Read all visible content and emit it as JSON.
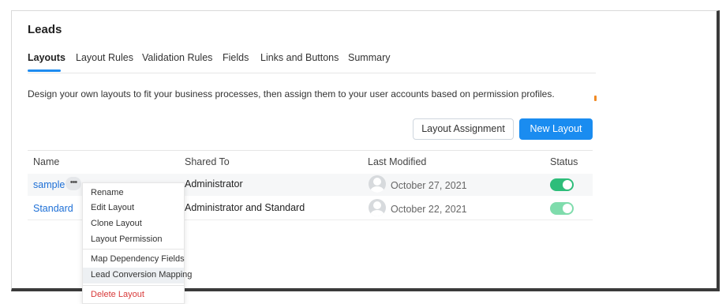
{
  "page": {
    "title": "Leads",
    "description": "Design your own layouts to fit your business processes, then assign them to your user accounts based on permission profiles."
  },
  "tabs": [
    {
      "label": "Layouts",
      "active": true
    },
    {
      "label": "Layout Rules",
      "active": false
    },
    {
      "label": "Validation Rules",
      "active": false
    },
    {
      "label": "Fields",
      "active": false
    },
    {
      "label": "Links and Buttons",
      "active": false
    },
    {
      "label": "Summary",
      "active": false
    }
  ],
  "actions": {
    "layout_assignment_label": "Layout Assignment",
    "new_layout_label": "New Layout"
  },
  "table": {
    "columns": [
      "Name",
      "Shared To",
      "Last Modified",
      "Status"
    ],
    "rows": [
      {
        "name": "sample",
        "more": "•••",
        "shared_to": "Administrator",
        "last_modified": "October 27, 2021",
        "status_on": true
      },
      {
        "name": "Standard",
        "shared_to": "Administrator and Standard",
        "last_modified": "October 22, 2021",
        "status_on": true
      }
    ]
  },
  "context_menu": {
    "items": [
      "Rename",
      "Edit Layout",
      "Clone Layout",
      "Layout Permission",
      "Map Dependency Fields",
      "Lead Conversion Mapping",
      "Delete Layout"
    ],
    "highlighted": "Lead Conversion Mapping"
  },
  "colors": {
    "accent": "#1a8cf0",
    "link": "#1d6fd6",
    "toggle_on": "#2ebd7a",
    "toggle_on_light": "#7fdcac",
    "danger": "#d83a3a"
  },
  "icons": {
    "more": "ellipsis-icon",
    "avatar": "user-avatar-icon",
    "status": "toggle-switch-icon"
  }
}
